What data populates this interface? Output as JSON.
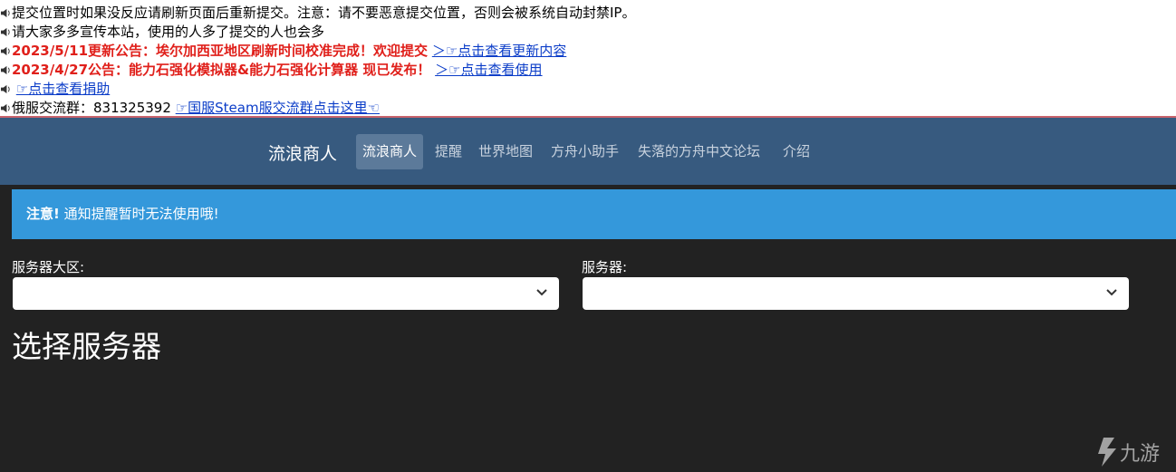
{
  "notices": {
    "line1": "提交位置时如果没反应请刷新页面后重新提交。注意：请不要恶意提交位置，否则会被系统自动封禁IP。",
    "line2": "请大家多多宣传本站，使用的人多了提交的人也会多",
    "line3_text": "2023/5/11更新公告：埃尔加西亚地区刷新时间校准完成！欢迎提交",
    "line3_link": "＞☞点击查看更新内容",
    "line4_text": "2023/4/27公告：能力石强化模拟器&能力石强化计算器 现已发布！",
    "line4_link": "＞☞点击查看使用",
    "line5_link": "☞点击查看捐助",
    "line6_text": "俄服交流群：831325392",
    "line6_link": "☞国服Steam服交流群点击这里☜"
  },
  "navbar": {
    "brand": "流浪商人",
    "items": [
      "流浪商人",
      "提醒",
      "世界地图",
      "方舟小助手",
      "失落的方舟中文论坛",
      "介绍"
    ]
  },
  "alert": {
    "strong": "注意!",
    "text": " 通知提醒暂时无法使用哦!"
  },
  "form": {
    "region_label": "服务器大区:",
    "server_label": "服务器:",
    "region_value": "",
    "server_value": ""
  },
  "heading": "选择服务器",
  "watermark": {
    "text": "九游"
  },
  "colors": {
    "navbar": "#375a7f",
    "background": "#222222",
    "alert": "#3498db",
    "notice_red": "#e0201b",
    "link": "#0a3cc8"
  }
}
